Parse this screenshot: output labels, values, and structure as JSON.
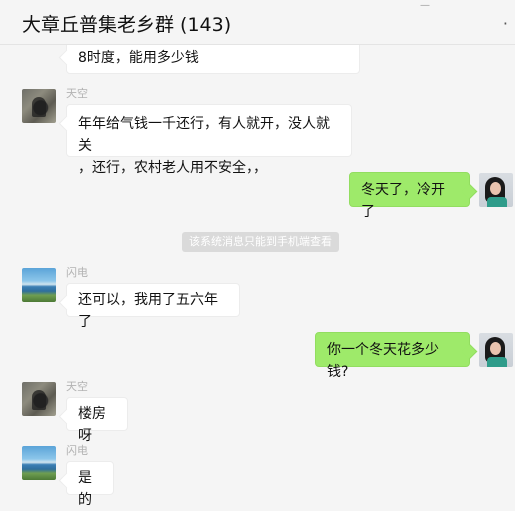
{
  "header": {
    "title": "大章丘普集老乡群 (143)",
    "more_icon": "more-icon"
  },
  "messages": [
    {
      "sender": "",
      "text": "8时度，能用多少钱"
    },
    {
      "sender": "天空",
      "text": "年年给气钱一千还行，有人就开，没人就关\n，还行，农村老人用不安全，，"
    },
    {
      "sender": "",
      "text": "冬天了，冷开了"
    },
    {
      "sender": "闪电",
      "text": "还可以，我用了五六年了"
    },
    {
      "sender": "",
      "text": "你一个冬天花多少钱?"
    },
    {
      "sender": "天空",
      "text": "楼房呀"
    },
    {
      "sender": "闪电",
      "text": "是的"
    }
  ],
  "system_notice": "该系统消息只能到手机端查看",
  "colors": {
    "background": "#f5f5f5",
    "self_bubble": "#9eea6a",
    "other_bubble": "#ffffff"
  }
}
